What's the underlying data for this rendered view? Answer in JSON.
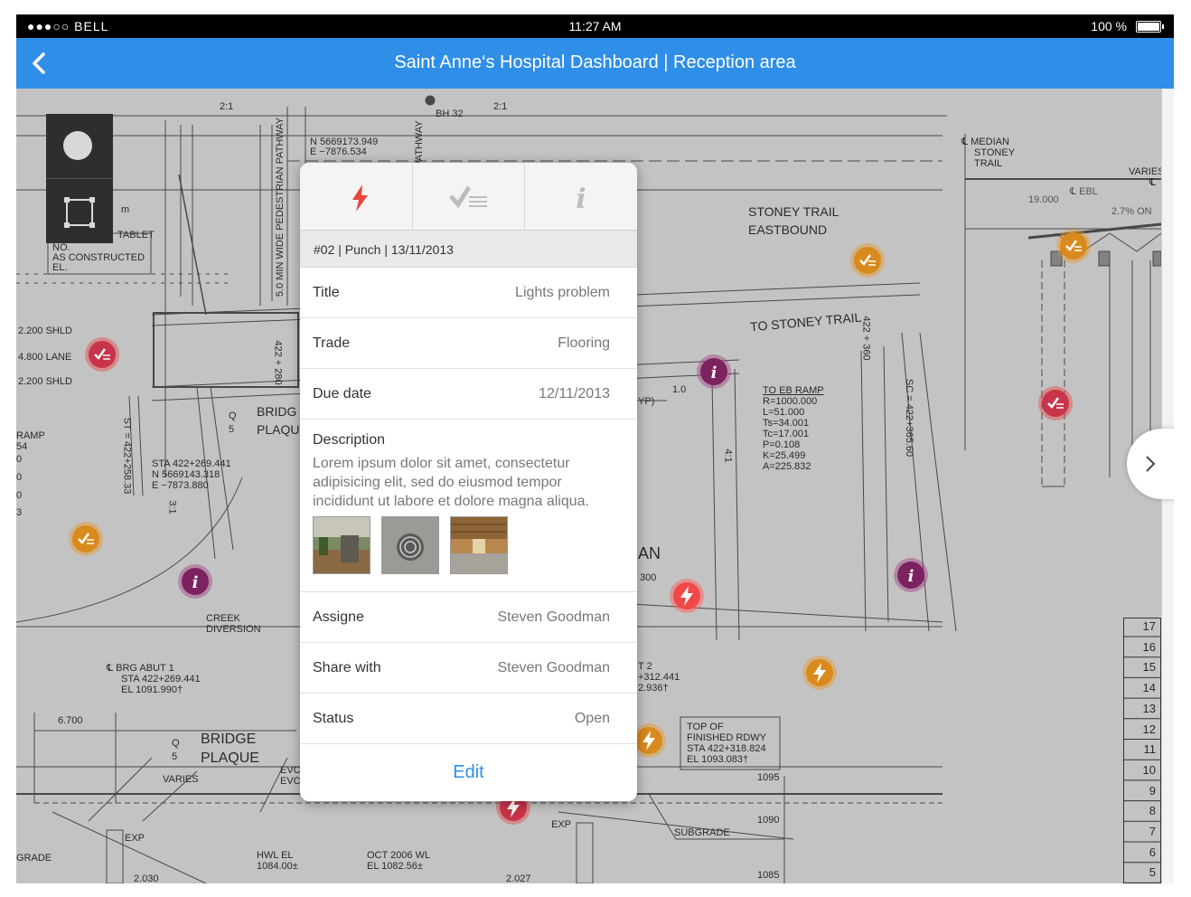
{
  "status_bar": {
    "signal": "●●●○○ BELL",
    "time": "11:27 AM",
    "battery": "100 %"
  },
  "nav": {
    "title": "Saint Anne‘s Hospital Dashboard | Reception area"
  },
  "colors": {
    "nav_blue": "#2f8ee8",
    "punch_red": "#e84848",
    "orange": "#d98a1c",
    "purple": "#7c2260"
  },
  "tools": [
    {
      "name": "circle-tool-icon"
    },
    {
      "name": "rectangle-tool-icon"
    }
  ],
  "popup": {
    "tabs": [
      {
        "icon": "lightning-icon"
      },
      {
        "icon": "checklist-icon"
      },
      {
        "icon": "info-icon"
      }
    ],
    "header": "#02  |  Punch  |  13/11/2013",
    "rows_top": [
      {
        "label": "Title",
        "value": "Lights problem"
      },
      {
        "label": "Trade",
        "value": "Flooring"
      },
      {
        "label": "Due date",
        "value": "12/11/2013"
      }
    ],
    "description": {
      "label": "Description",
      "text": "Lorem ipsum dolor sit amet, consectetur adipisicing elit, sed do eiusmod tempor incididunt ut labore et dolore magna aliqua."
    },
    "rows_bottom": [
      {
        "label": "Assigne",
        "value": "Steven Goodman"
      },
      {
        "label": "Share with",
        "value": "Steven Goodman"
      },
      {
        "label": "Status",
        "value": "Open"
      }
    ],
    "edit_label": "Edit"
  },
  "blueprint_labels": {
    "a1": "2:1",
    "a2": "BH  32",
    "a3": "2:1",
    "a4": "N  5669173.949",
    "a5": "E  −7876.534",
    "a6": "5.0 MIN WIDE PEDESTRIAN PATHWAY",
    "a7": "PATHWAY",
    "a8": "℄ MEDIAN",
    "a9": "STONEY",
    "a10": "TRAIL",
    "a11": "VARIES",
    "a12": "℄",
    "a13": "19.000",
    "a14": "℄ EBL",
    "a15": "2.7%  ON",
    "a16": "STONEY  TRAIL",
    "a17": "EASTBOUND",
    "a18": "TO  STONEY  TRAIL",
    "a19": "422 + 360",
    "a20": "TABLET",
    "a21": "NO.",
    "a22": "AS  CONSTRUCTED",
    "a23": "EL.",
    "a24": "m",
    "a25": "2.200  SHLD",
    "a26": "4.800  LANE",
    "a27": "2.200  SHLD",
    "a28": "RAMP",
    "a29": "54",
    "a30": "0",
    "a31": "0",
    "a32": "0",
    "a33": "3",
    "a34": "BRIDG",
    "a35": "PLAQU",
    "a36": "Q",
    "a37": "5",
    "a38": "STA  422+269.441",
    "a39": "N  5669143.318",
    "a40": "E  −7873.880",
    "a41": "ST = 422+258.33",
    "a42": "3:1",
    "a43": "422 + 280",
    "a44": "1.0",
    "a45": "YP)",
    "a46": "4:1",
    "a47": "TO  EB  RAMP",
    "a48": "R=1000.000",
    "a49": "L=51.000",
    "a50": "Ts=34.001",
    "a51": "Tc=17.001",
    "a52": "P=0.108",
    "a53": "K=25.499",
    "a54": "A=225.832",
    "a55": "SC = 422+365.60",
    "a56": "AN",
    "a57": "300",
    "a58": "CREEK",
    "a59": "DIVERSION",
    "a60": "℄ BRG  ABUT  1",
    "a61": "STA  422+269.441",
    "a62": "EL   1091.990†",
    "a63": "T 2",
    "a64": "+312.441",
    "a65": "2.936†",
    "a66": "TOP  OF",
    "a67": "FINISHED  RDWY",
    "a68": "STA  422+318.824",
    "a69": "EL  1093.083†",
    "a70": "1095",
    "a71": "1090",
    "a72": "1085",
    "a73": "SUBGRADE",
    "a74": "6.700",
    "a75": "BRIDGE",
    "a76": "PLAQUE",
    "a77": "Q",
    "a78": "5",
    "a79": "VARIES",
    "a80": "EVC",
    "a81": "EVC",
    "a82": "EXP",
    "a83": "EXP",
    "a84": "GRADE",
    "a85": "HWL  EL",
    "a86": "1084.00±",
    "a87": "OCT  2006  WL",
    "a88": "EL  1082.56±",
    "a89": "2.030",
    "a90": "2.027"
  },
  "ruler": [
    "17",
    "16",
    "15",
    "14",
    "13",
    "12",
    "11",
    "10",
    "9",
    "8",
    "7",
    "6",
    "5"
  ]
}
